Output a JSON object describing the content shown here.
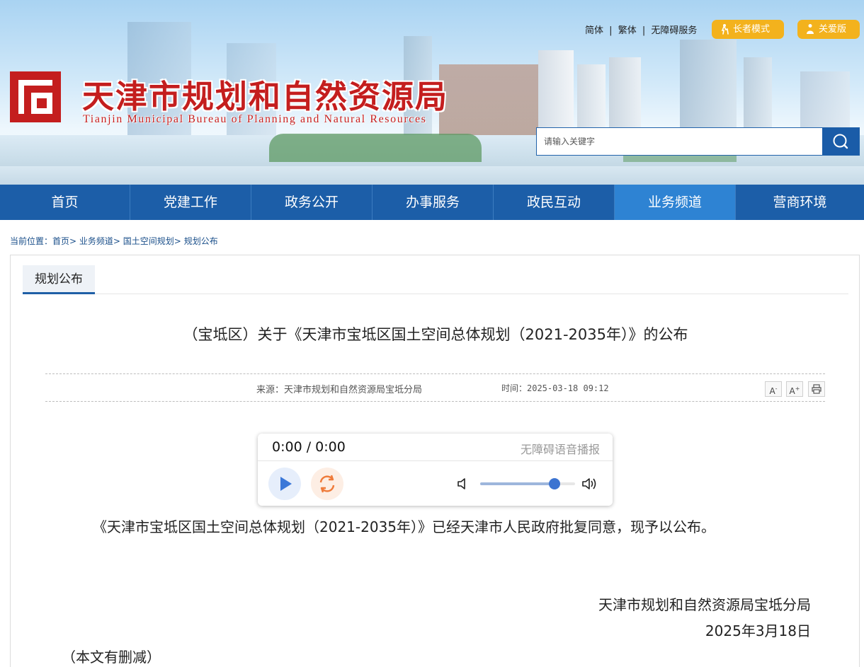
{
  "header": {
    "title_cn": "天津市规划和自然资源局",
    "title_en": "Tianjin Municipal Bureau of Planning and Natural Resources",
    "links": [
      "简体",
      "|",
      "繁体",
      "|",
      "无障碍服务"
    ],
    "elder_mode": "长者模式",
    "care_mode": "关爱版",
    "search_placeholder": "请输入关键字",
    "brand_red": "#c41e1e",
    "accent_blue": "#1c5ea8",
    "pill_yellow": "#f3b21d"
  },
  "nav": {
    "items": [
      "首页",
      "党建工作",
      "政务公开",
      "办事服务",
      "政民互动",
      "业务频道",
      "营商环境"
    ],
    "active": "业务频道"
  },
  "breadcrumb": [
    "当前位置：",
    "首页>",
    "业务频道>",
    "国土空间规划>",
    "规划公布"
  ],
  "tab": "规划公布",
  "article": {
    "title": "（宝坻区）关于《天津市宝坻区国土空间总体规划（2021-2035年）》的公布",
    "source": "来源：天津市规划和自然资源局宝坻分局",
    "time": "时间：2025-03-18 09:12",
    "tools": [
      "A-",
      "A+",
      "print-icon"
    ],
    "body": "《天津市宝坻区国土空间总体规划（2021-2035年）》已经天津市人民政府批复同意，现予以公布。",
    "signature": "天津市规划和自然资源局宝坻分局",
    "date": "2025年3月18日",
    "note": "（本文有删减）"
  },
  "player": {
    "time": "0:00 / 0:00",
    "label": "无障碍语音播报",
    "volume": 0.78
  }
}
